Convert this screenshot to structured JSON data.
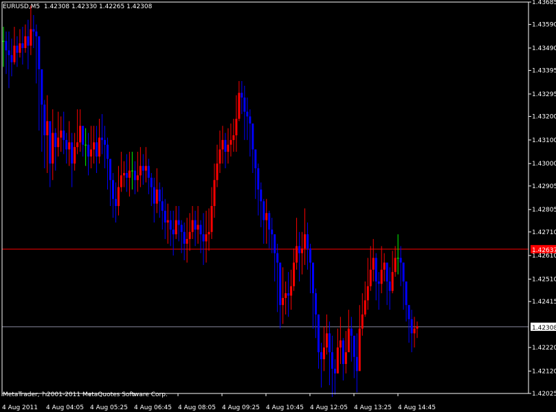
{
  "header": {
    "symbol": "EURUSD,M5",
    "ohlc": "1.42308 1.42330 1.42265 1.42308"
  },
  "footer": {
    "copyright": "MetaTrader, ? 2001-2011 MetaQuotes Software Corp."
  },
  "colors": {
    "background": "#000000",
    "frame": "#ffffff",
    "bull_candle": "#ff0000",
    "bear_candle": "#0000ff",
    "doji_candle": "#00ff00",
    "ask_line": "#ff0000",
    "bid_line": "#8a8aa0"
  },
  "chart_data": {
    "type": "candlestick",
    "title": "EURUSD,M5",
    "xlabel": "",
    "ylabel": "",
    "ylim": [
      1.42025,
      1.43685
    ],
    "grid": false,
    "y_ticks": [
      "1.43685",
      "1.43590",
      "1.43490",
      "1.43395",
      "1.43295",
      "1.43200",
      "1.43100",
      "1.43000",
      "1.42905",
      "1.42805",
      "1.42710",
      "1.42610",
      "1.42510",
      "1.42415",
      "1.42308",
      "1.42220",
      "1.42120",
      "1.42025"
    ],
    "x_ticks": [
      "4 Aug 2011",
      "4 Aug 04:05",
      "4 Aug 05:25",
      "4 Aug 06:45",
      "4 Aug 08:05",
      "4 Aug 09:25",
      "4 Aug 10:45",
      "4 Aug 12:05",
      "4 Aug 13:25",
      "4 Aug 14:45"
    ],
    "price_labels": {
      "ask": {
        "label": "1.42637",
        "value": 1.42637
      },
      "bid": {
        "label": "1.42308",
        "value": 1.42308
      }
    },
    "series": [
      {
        "name": "EURUSD,M5",
        "closes": [
          1.4352,
          1.4348,
          1.4346,
          1.4343,
          1.435,
          1.4347,
          1.4351,
          1.4349,
          1.4354,
          1.435,
          1.4357,
          1.4356,
          1.4354,
          1.434,
          1.4325,
          1.4312,
          1.4318,
          1.43,
          1.4313,
          1.4307,
          1.4311,
          1.4314,
          1.431,
          1.4306,
          1.4309,
          1.43,
          1.4307,
          1.4309,
          1.4316,
          1.4308,
          1.4308,
          1.4303,
          1.4306,
          1.4309,
          1.4303,
          1.4311,
          1.431,
          1.4308,
          1.4302,
          1.4293,
          1.4285,
          1.4282,
          1.429,
          1.4295,
          1.4296,
          1.4294,
          1.4297,
          1.4297,
          1.4293,
          1.4295,
          1.4299,
          1.4297,
          1.4299,
          1.4294,
          1.429,
          1.4283,
          1.4289,
          1.4284,
          1.428,
          1.4275,
          1.4276,
          1.4272,
          1.427,
          1.4276,
          1.4274,
          1.4271,
          1.4266,
          1.4268,
          1.4271,
          1.4276,
          1.4272,
          1.4274,
          1.427,
          1.4267,
          1.427,
          1.4271,
          1.4282,
          1.4293,
          1.43,
          1.4306,
          1.431,
          1.4305,
          1.4308,
          1.431,
          1.4312,
          1.4319,
          1.433,
          1.4328,
          1.4322,
          1.432,
          1.4317,
          1.4306,
          1.4298,
          1.4289,
          1.4284,
          1.4276,
          1.4279,
          1.4272,
          1.427,
          1.4262,
          1.4258,
          1.424,
          1.4243,
          1.4245,
          1.4244,
          1.4248,
          1.4258,
          1.4265,
          1.4262,
          1.4264,
          1.427,
          1.4264,
          1.4258,
          1.4245,
          1.4236,
          1.422,
          1.4217,
          1.4222,
          1.4228,
          1.422,
          1.4213,
          1.4211,
          1.4222,
          1.4225,
          1.4215,
          1.422,
          1.423,
          1.4227,
          1.4218,
          1.4212,
          1.423,
          1.4236,
          1.4242,
          1.4248,
          1.4255,
          1.426,
          1.425,
          1.4249,
          1.4255,
          1.4258,
          1.425,
          1.4246,
          1.4254,
          1.426,
          1.426,
          1.4258,
          1.425,
          1.424,
          1.4234,
          1.4228,
          1.423,
          1.4231
        ],
        "lows": [
          1.4341,
          1.4338,
          1.4332,
          1.4337,
          1.4342,
          1.4341,
          1.4345,
          1.4342,
          1.4347,
          1.434,
          1.4346,
          1.4349,
          1.4334,
          1.4314,
          1.4305,
          1.4298,
          1.4296,
          1.429,
          1.4293,
          1.4297,
          1.4303,
          1.4305,
          1.4304,
          1.43,
          1.4299,
          1.429,
          1.4297,
          1.4304,
          1.4305,
          1.4303,
          1.4299,
          1.4295,
          1.4298,
          1.43,
          1.4296,
          1.43,
          1.4304,
          1.4298,
          1.4289,
          1.4282,
          1.4277,
          1.4275,
          1.4278,
          1.4288,
          1.429,
          1.4288,
          1.4286,
          1.4289,
          1.4287,
          1.4288,
          1.429,
          1.4291,
          1.4292,
          1.4287,
          1.4282,
          1.4275,
          1.4279,
          1.4277,
          1.4272,
          1.4268,
          1.4266,
          1.4265,
          1.4261,
          1.4268,
          1.4267,
          1.4262,
          1.4259,
          1.4258,
          1.4263,
          1.4268,
          1.4265,
          1.4266,
          1.4262,
          1.4257,
          1.4258,
          1.4263,
          1.4268,
          1.4277,
          1.429,
          1.4296,
          1.43,
          1.4298,
          1.43,
          1.4303,
          1.4305,
          1.4305,
          1.4318,
          1.4321,
          1.431,
          1.431,
          1.4303,
          1.4296,
          1.4285,
          1.4278,
          1.4273,
          1.4266,
          1.4266,
          1.4264,
          1.4262,
          1.425,
          1.4237,
          1.423,
          1.4232,
          1.4236,
          1.4235,
          1.4238,
          1.4246,
          1.4255,
          1.425,
          1.4253,
          1.4257,
          1.4255,
          1.4245,
          1.423,
          1.4226,
          1.4213,
          1.4205,
          1.4212,
          1.4219,
          1.4206,
          1.4201,
          1.4202,
          1.4213,
          1.4215,
          1.4208,
          1.4211,
          1.4223,
          1.4216,
          1.4209,
          1.4203,
          1.4218,
          1.4227,
          1.4235,
          1.4238,
          1.4246,
          1.425,
          1.4242,
          1.4238,
          1.4245,
          1.425,
          1.424,
          1.4238,
          1.4245,
          1.4252,
          1.4253,
          1.4248,
          1.4238,
          1.4233,
          1.4224,
          1.422,
          1.4222,
          1.4226
        ],
        "highs": [
          1.4358,
          1.4356,
          1.4356,
          1.4353,
          1.4358,
          1.4354,
          1.4357,
          1.4358,
          1.4359,
          1.4361,
          1.4367,
          1.4363,
          1.4359,
          1.435,
          1.4335,
          1.4327,
          1.4329,
          1.4316,
          1.4323,
          1.4315,
          1.4322,
          1.432,
          1.4322,
          1.4313,
          1.4318,
          1.4313,
          1.4313,
          1.4323,
          1.4323,
          1.4314,
          1.4315,
          1.4313,
          1.4316,
          1.4316,
          1.4316,
          1.4319,
          1.4321,
          1.4316,
          1.4311,
          1.43,
          1.4296,
          1.4292,
          1.4299,
          1.4305,
          1.4301,
          1.4304,
          1.4305,
          1.4305,
          1.4301,
          1.4305,
          1.4307,
          1.4304,
          1.4307,
          1.4302,
          1.4296,
          1.4294,
          1.4298,
          1.4292,
          1.429,
          1.4285,
          1.4283,
          1.428,
          1.428,
          1.4282,
          1.4282,
          1.4276,
          1.4275,
          1.4277,
          1.4279,
          1.4282,
          1.428,
          1.4282,
          1.4276,
          1.4279,
          1.428,
          1.4281,
          1.429,
          1.43,
          1.4308,
          1.4314,
          1.4316,
          1.4313,
          1.4315,
          1.4317,
          1.4319,
          1.4329,
          1.4335,
          1.4335,
          1.4333,
          1.4328,
          1.4323,
          1.4313,
          1.4306,
          1.43,
          1.4292,
          1.4285,
          1.4285,
          1.428,
          1.4277,
          1.427,
          1.4266,
          1.4254,
          1.4256,
          1.425,
          1.4254,
          1.4255,
          1.4264,
          1.4277,
          1.4271,
          1.4271,
          1.4281,
          1.4275,
          1.4266,
          1.4257,
          1.4247,
          1.4236,
          1.4224,
          1.4231,
          1.4236,
          1.4233,
          1.4227,
          1.4217,
          1.423,
          1.4235,
          1.4226,
          1.4229,
          1.4238,
          1.4235,
          1.4225,
          1.4228,
          1.424,
          1.4245,
          1.425,
          1.426,
          1.4265,
          1.4268,
          1.4262,
          1.4254,
          1.4265,
          1.4262,
          1.4257,
          1.4256,
          1.4263,
          1.4265,
          1.427,
          1.4265,
          1.4258,
          1.4247,
          1.424,
          1.4238,
          1.4235,
          1.4233
        ]
      }
    ]
  }
}
